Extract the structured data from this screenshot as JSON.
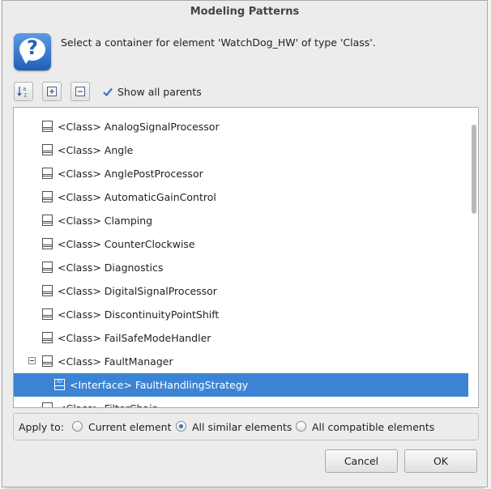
{
  "dialog": {
    "title": "Modeling Patterns",
    "message": "Select a container for element 'WatchDog_HW' of type 'Class'."
  },
  "toolbar": {
    "sort_icon": "sort-alpha-icon",
    "expand_icon": "expand-all-icon",
    "collapse_icon": "collapse-all-icon",
    "show_all_parents": {
      "label": "Show all parents",
      "checked": true
    }
  },
  "tree": {
    "items": [
      {
        "label": "<Class> AnalogSignalProcessor",
        "icon": "class-icon"
      },
      {
        "label": "<Class> Angle",
        "icon": "class-icon"
      },
      {
        "label": "<Class> AnglePostProcessor",
        "icon": "class-icon"
      },
      {
        "label": "<Class> AutomaticGainControl",
        "icon": "class-icon"
      },
      {
        "label": "<Class> Clamping",
        "icon": "class-icon"
      },
      {
        "label": "<Class> CounterClockwise",
        "icon": "class-icon"
      },
      {
        "label": "<Class> Diagnostics",
        "icon": "class-icon"
      },
      {
        "label": "<Class> DigitalSignalProcessor",
        "icon": "class-icon"
      },
      {
        "label": "<Class> DiscontinuityPointShift",
        "icon": "class-icon"
      },
      {
        "label": "<Class> FailSafeModeHandler",
        "icon": "class-icon"
      },
      {
        "label": "<Class> FaultManager",
        "icon": "class-icon",
        "expanded": true
      },
      {
        "label": "<Interface> FaultHandlingStrategy",
        "icon": "interface-icon",
        "selected": true
      },
      {
        "label": "<Class> FilterChain",
        "icon": "class-icon"
      }
    ],
    "selection_color": "#3c84d3"
  },
  "apply_to": {
    "label": "Apply to:",
    "options": [
      {
        "label": "Current element",
        "selected": false
      },
      {
        "label": "All similar elements",
        "selected": true
      },
      {
        "label": "All compatible elements",
        "selected": false
      }
    ]
  },
  "buttons": {
    "cancel": "Cancel",
    "ok": "OK"
  }
}
